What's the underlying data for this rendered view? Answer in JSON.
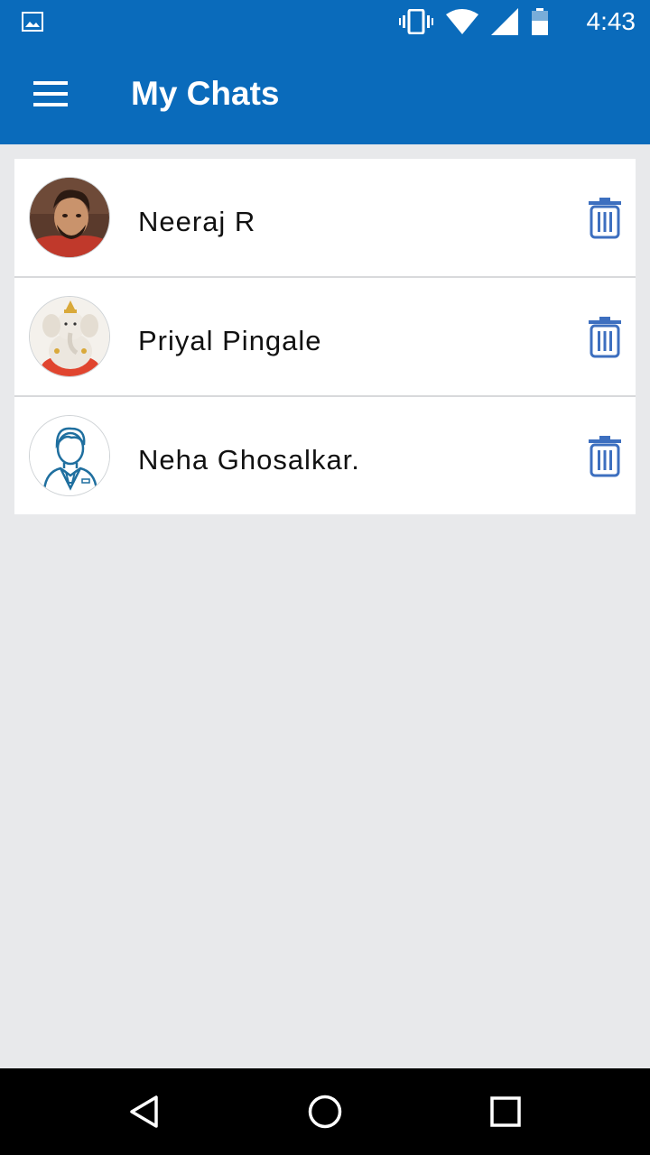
{
  "status_bar": {
    "time": "4:43",
    "icons": [
      "image-icon",
      "vibrate-icon",
      "wifi-icon",
      "signal-icon",
      "battery-icon"
    ]
  },
  "app_bar": {
    "title": "My Chats",
    "menu_icon": "hamburger-menu-icon"
  },
  "colors": {
    "primary": "#0a6bbb",
    "background": "#e8e9eb",
    "delete_icon": "#3d6fbf"
  },
  "chats": [
    {
      "name": "Neeraj R",
      "avatar": "photo-man",
      "action_icon": "trash-icon"
    },
    {
      "name": "Priyal Pingale",
      "avatar": "photo-ganesha",
      "action_icon": "trash-icon"
    },
    {
      "name": "Neha Ghosalkar.",
      "avatar": "default-user-outline",
      "action_icon": "trash-icon"
    }
  ],
  "nav_bar": {
    "buttons": [
      "back-icon",
      "home-icon",
      "recents-icon"
    ]
  }
}
